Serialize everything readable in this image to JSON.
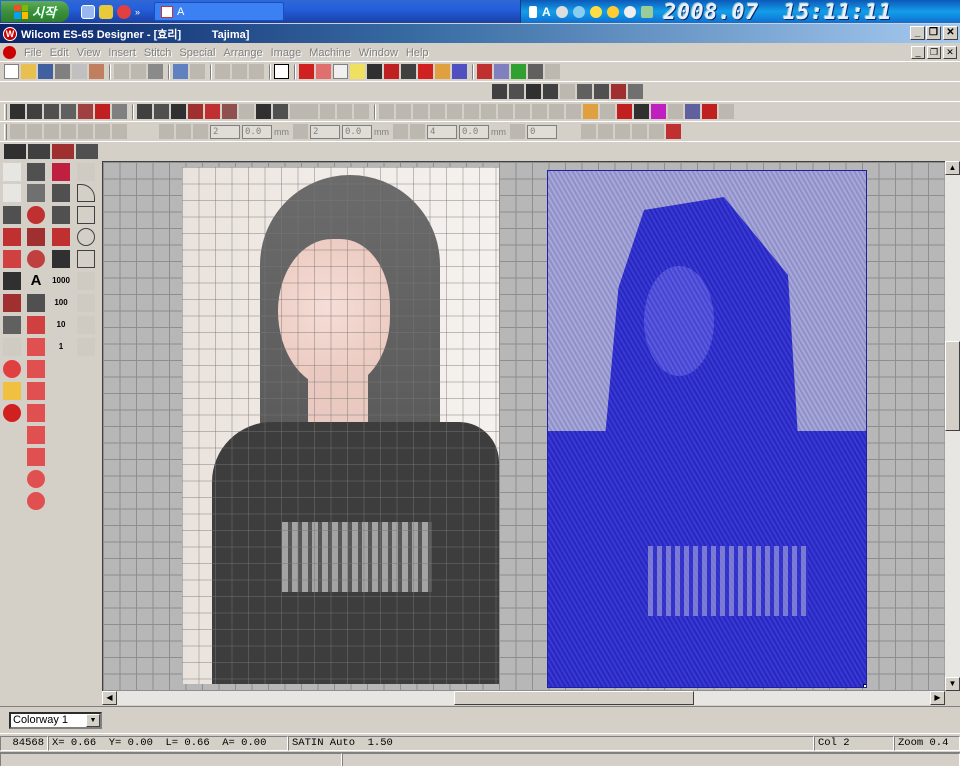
{
  "taskbar": {
    "start_label": "시작",
    "task_label": "A",
    "clock_date": "2008.07",
    "clock_time": "15:11:11"
  },
  "window": {
    "title_app": "Wilcom ES-65 Designer - ",
    "title_doc": "[효리]",
    "title_machine": "Tajima]"
  },
  "menu": {
    "items": [
      "File",
      "Edit",
      "View",
      "Insert",
      "Stitch",
      "Special",
      "Arrange",
      "Image",
      "Machine",
      "Window",
      "Help"
    ]
  },
  "toolbar": {
    "spin_a": "2",
    "spin_b": "0.0",
    "spin_c": "2",
    "spin_d": "0.0",
    "spin_e": "4",
    "spin_f": "0.0",
    "spin_g": "0",
    "unit_mm": "mm",
    "palette_numbers": [
      "1000",
      "100",
      "10",
      "1"
    ]
  },
  "colorway": {
    "selected": "Colorway 1"
  },
  "status": {
    "stitch_count": "84568",
    "x_label": "X=",
    "x_value": "0.66",
    "y_label": "Y=",
    "y_value": "0.00",
    "l_label": "L=",
    "l_value": "0.66",
    "a_label": "A=",
    "a_value": "0.00",
    "stitch_type": "SATIN Auto",
    "density": "1.50",
    "color": "Col 2",
    "zoom": "Zoom 0.4"
  },
  "colors": {
    "accent_blue": "#0a246a",
    "embroidery_blue": "#2828bf",
    "canvas_grey": "#b7b7b7"
  }
}
